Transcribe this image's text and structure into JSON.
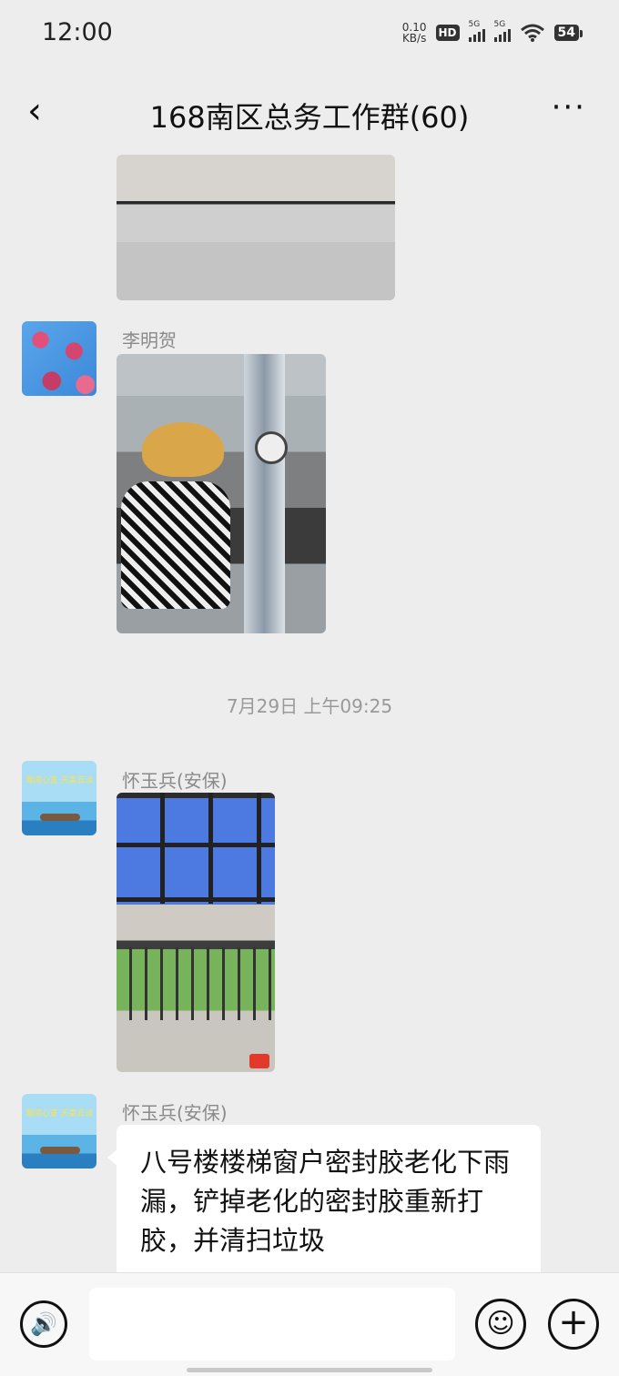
{
  "status_bar": {
    "time": "12:00",
    "net_speed_value": "0.10",
    "net_speed_unit": "KB/s",
    "hd_label": "HD",
    "signal_1": "5G",
    "signal_2": "5G",
    "battery": "54"
  },
  "header": {
    "title": "168南区总务工作群(60)",
    "back_icon": "chevron-left-icon",
    "more_icon": "ellipsis-icon",
    "back_glyph": "‹",
    "more_glyph": "···"
  },
  "messages": [
    {
      "type": "image",
      "description": "partial image (top)"
    },
    {
      "sender": "李明贺",
      "type": "image"
    },
    {
      "timestamp": "7月29日 上午09:25"
    },
    {
      "sender": "怀玉兵(安保)",
      "type": "image",
      "avatar_text": "海阔心宽 天高云淡"
    },
    {
      "sender": "怀玉兵(安保)",
      "type": "text",
      "text": "八号楼楼梯窗户密封胶老化下雨漏，铲掉老化的密封胶重新打胶，并清扫垃圾",
      "avatar_text": "海阔心宽 天高云淡"
    }
  ],
  "input_bar": {
    "voice_icon": "voice-icon",
    "emoji_icon": "emoji-icon",
    "plus_icon": "plus-icon",
    "voice_glyph": "🔊",
    "emoji_glyph": "☺",
    "plus_glyph": "+",
    "placeholder": ""
  }
}
